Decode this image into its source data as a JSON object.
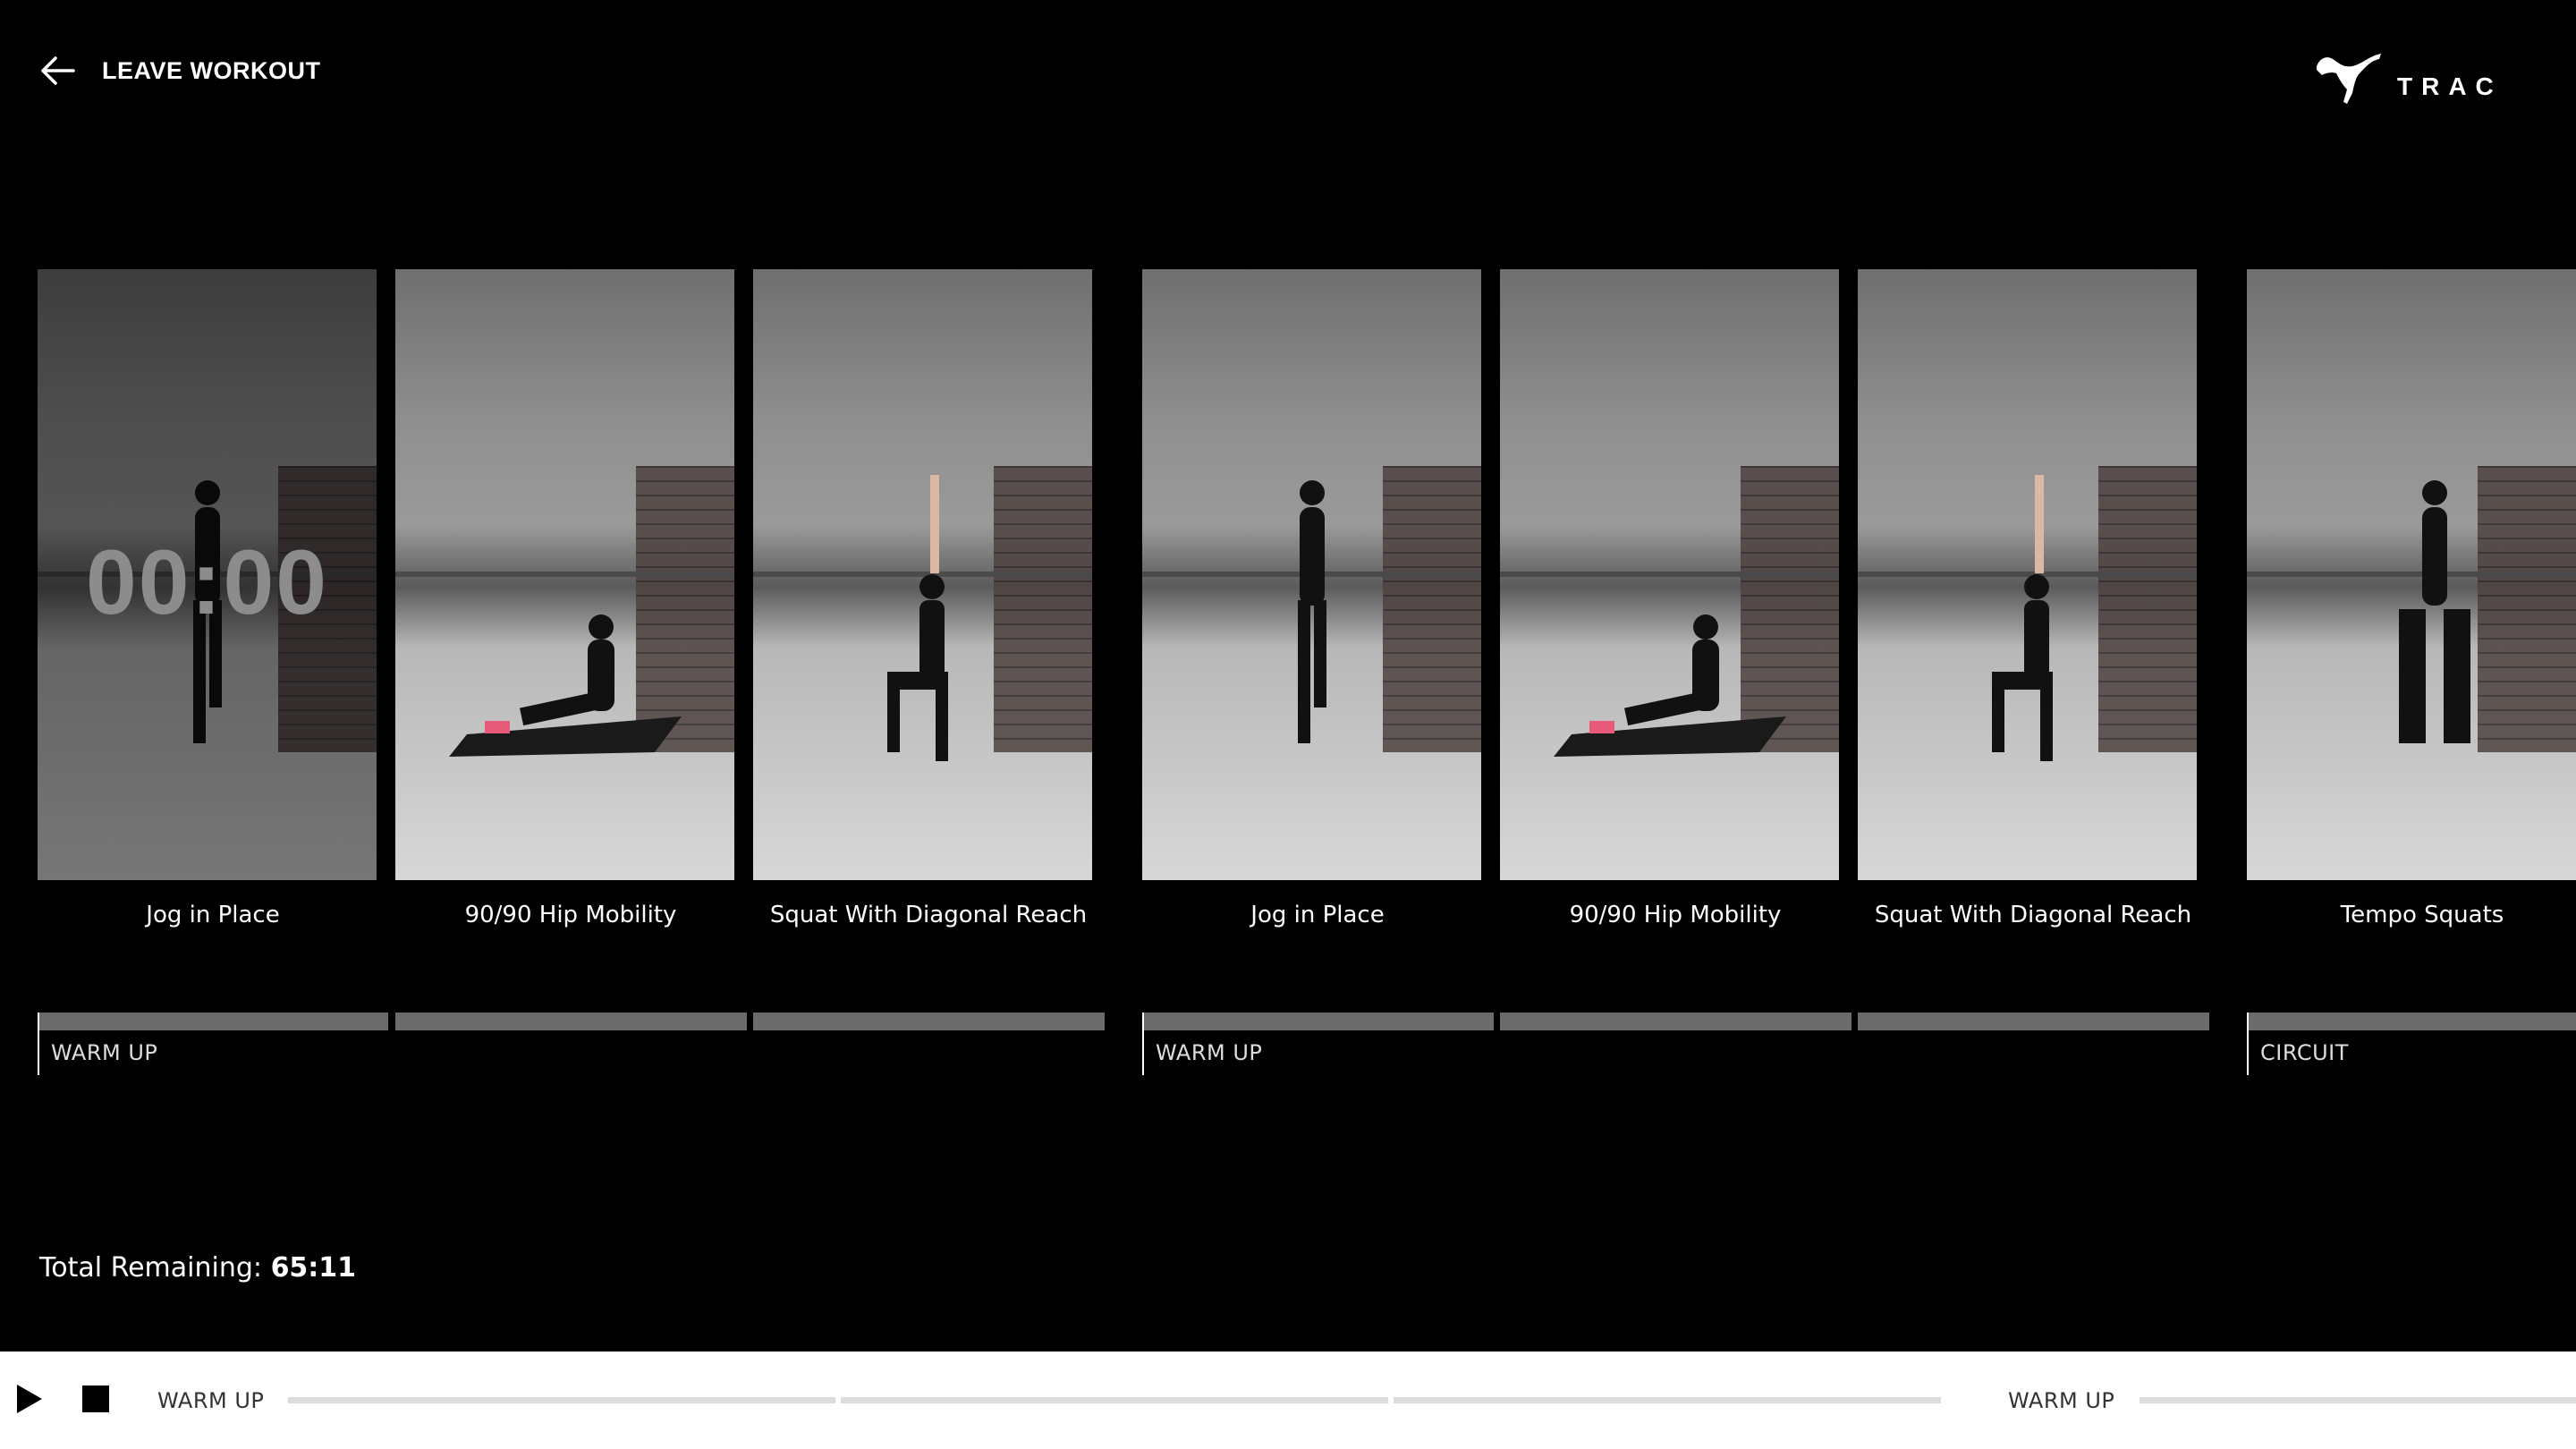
{
  "header": {
    "leave_label": "LEAVE WORKOUT",
    "logo_text": "TRAC"
  },
  "active_timer": "00:00",
  "exercises": [
    {
      "label": "Jog in Place"
    },
    {
      "label": "90/90 Hip Mobility"
    },
    {
      "label": "Squat With Diagonal Reach"
    },
    {
      "label": "Jog in Place"
    },
    {
      "label": "90/90 Hip Mobility"
    },
    {
      "label": "Squat With Diagonal Reach"
    },
    {
      "label": "Tempo Squats"
    }
  ],
  "sections": [
    {
      "label": "WARM UP"
    },
    {
      "label": "WARM UP"
    },
    {
      "label": "CIRCUIT"
    }
  ],
  "total": {
    "label": "Total Remaining:",
    "value": "65:11"
  },
  "bottom_bar": {
    "section_1": "WARM UP",
    "section_2": "WARM UP"
  },
  "colors": {
    "background": "#000000",
    "bar": "#ffffff",
    "segment": "#6b6b6b"
  },
  "icons": {
    "back": "arrow-left-icon",
    "play": "play-icon",
    "stop": "stop-icon",
    "logo": "puma-cat-icon"
  }
}
